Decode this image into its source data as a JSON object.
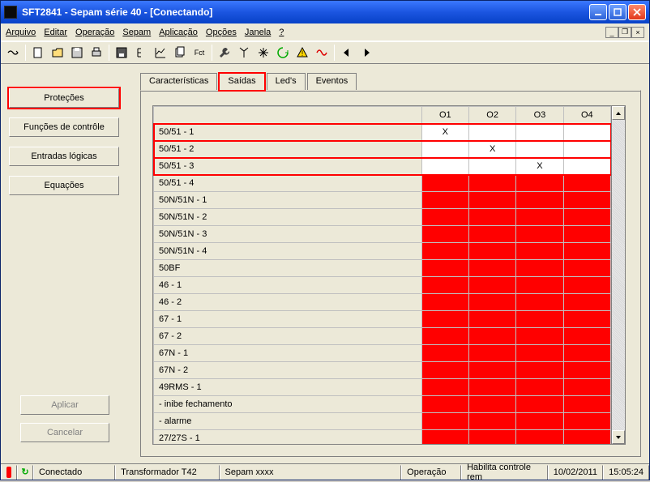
{
  "window": {
    "title": "SFT2841 - Sepam série 40 - [Conectando]"
  },
  "menu": {
    "items": [
      {
        "label": "Arquivo"
      },
      {
        "label": "Editar"
      },
      {
        "label": "Operação"
      },
      {
        "label": "Sepam"
      },
      {
        "label": "Aplicação"
      },
      {
        "label": "Opções"
      },
      {
        "label": "Janela"
      },
      {
        "label": "?"
      }
    ]
  },
  "sidebar": {
    "protecoes": "Proteções",
    "funcoes": "Funções de contrôle",
    "entradas": "Entradas lógicas",
    "equacoes": "Equações",
    "aplicar": "Aplicar",
    "cancelar": "Cancelar"
  },
  "tabs": {
    "caracteristicas": "Características",
    "saidas": "Saídas",
    "leds": "Led's",
    "eventos": "Eventos"
  },
  "table": {
    "col_headers": [
      "O1",
      "O2",
      "O3",
      "O4"
    ],
    "rows": [
      {
        "label": "50/51 - 1",
        "cells": [
          "X",
          "",
          "",
          ""
        ],
        "red": false
      },
      {
        "label": "50/51 - 2",
        "cells": [
          "",
          "X",
          "",
          ""
        ],
        "red": false
      },
      {
        "label": "50/51 - 3",
        "cells": [
          "",
          "",
          "X",
          ""
        ],
        "red": false
      },
      {
        "label": "50/51 - 4",
        "cells": [
          "",
          "",
          "",
          ""
        ],
        "red": true
      },
      {
        "label": "50N/51N - 1",
        "cells": [
          "",
          "",
          "",
          ""
        ],
        "red": true
      },
      {
        "label": "50N/51N - 2",
        "cells": [
          "",
          "",
          "",
          ""
        ],
        "red": true
      },
      {
        "label": "50N/51N - 3",
        "cells": [
          "",
          "",
          "",
          ""
        ],
        "red": true
      },
      {
        "label": "50N/51N - 4",
        "cells": [
          "",
          "",
          "",
          ""
        ],
        "red": true
      },
      {
        "label": "50BF",
        "cells": [
          "",
          "",
          "",
          ""
        ],
        "red": true
      },
      {
        "label": "46 - 1",
        "cells": [
          "",
          "",
          "",
          ""
        ],
        "red": true
      },
      {
        "label": "46 - 2",
        "cells": [
          "",
          "",
          "",
          ""
        ],
        "red": true
      },
      {
        "label": "67 - 1",
        "cells": [
          "",
          "",
          "",
          ""
        ],
        "red": true
      },
      {
        "label": "67 - 2",
        "cells": [
          "",
          "",
          "",
          ""
        ],
        "red": true
      },
      {
        "label": "67N - 1",
        "cells": [
          "",
          "",
          "",
          ""
        ],
        "red": true
      },
      {
        "label": "67N - 2",
        "cells": [
          "",
          "",
          "",
          ""
        ],
        "red": true
      },
      {
        "label": "49RMS - 1",
        "cells": [
          "",
          "",
          "",
          ""
        ],
        "red": true
      },
      {
        "label": "    - inibe fechamento",
        "cells": [
          "",
          "",
          "",
          ""
        ],
        "red": true
      },
      {
        "label": "    - alarme",
        "cells": [
          "",
          "",
          "",
          ""
        ],
        "red": true
      },
      {
        "label": "27/27S - 1",
        "cells": [
          "",
          "",
          "",
          ""
        ],
        "red": true
      }
    ]
  },
  "status": {
    "conectado": "Conectado",
    "transformador": "Transformador T42",
    "sepam": "Sepam xxxx",
    "operacao": "Operação",
    "habilita": "Habilita controle rem",
    "date": "10/02/2011",
    "time": "15:05:24"
  }
}
